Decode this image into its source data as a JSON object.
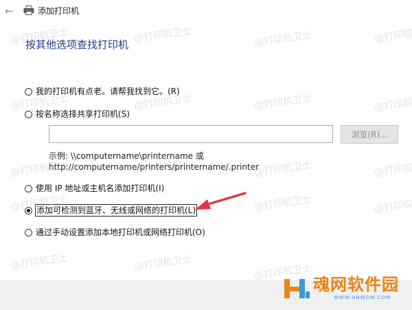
{
  "window": {
    "title": "添加打印机",
    "back_icon": "←"
  },
  "heading": "按其他选项查找打印机",
  "options": [
    {
      "label": "我的打印机有点老。请帮我找到它。(R)",
      "checked": false
    },
    {
      "label": "按名称选择共享打印机(S)",
      "checked": false
    },
    {
      "label": "使用 IP 地址或主机名添加打印机(I)",
      "checked": false
    },
    {
      "label": "添加可检测到蓝牙、无线或网络的打印机(L)",
      "checked": true
    },
    {
      "label": "通过手动设置添加本地打印机或网络打印机(O)",
      "checked": false
    }
  ],
  "share_input": {
    "value": "",
    "placeholder": ""
  },
  "browse_label": "浏览(R)...",
  "example_line1": "示例: \\\\computername\\printername 或",
  "example_line2": "http://computername/printers/printername/.printer",
  "watermark_text": "@打印机卫士",
  "logo": {
    "name": "魂网软件园",
    "url": "WWW.HNWDW.COM"
  },
  "colors": {
    "heading": "#1c3c8c",
    "arrow": "#e8343a",
    "logo_orange": "#e8841a",
    "logo_blue": "#3a9ad9"
  }
}
